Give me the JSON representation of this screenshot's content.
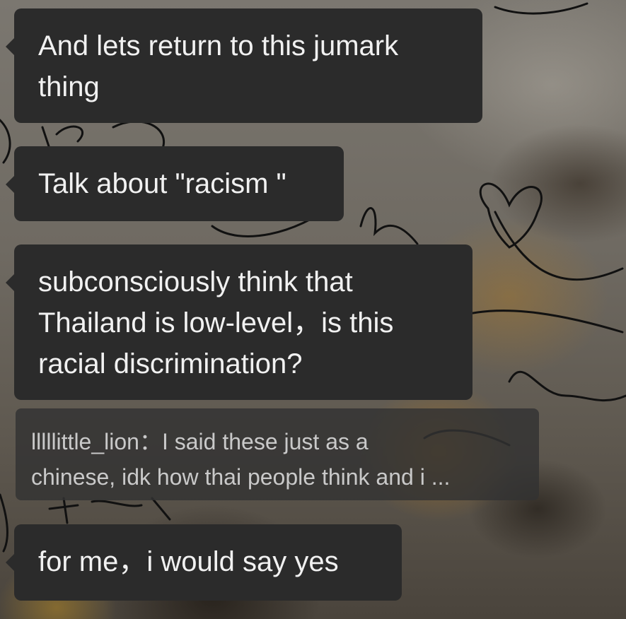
{
  "messages": [
    {
      "text": "And lets return to this jumark\nthing"
    },
    {
      "text": "Talk about \"racism \""
    },
    {
      "text": "subconsciously think that\nThailand is low-level，is this\nracial discrimination?"
    }
  ],
  "quote": {
    "author": "lllllittle_lion",
    "separator": "：",
    "text": "I said these just as a\nchinese, idk how thai people think and i ..."
  },
  "reply": {
    "text": "for me，i would say yes"
  }
}
